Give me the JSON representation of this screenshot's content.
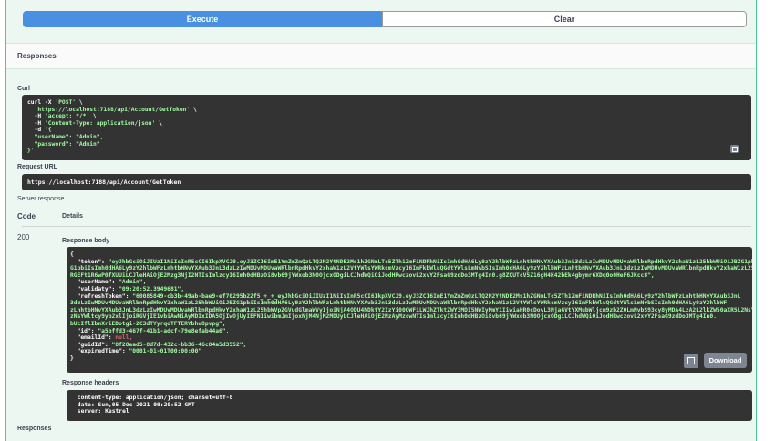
{
  "buttons": {
    "execute": "Execute",
    "clear": "Clear"
  },
  "responses_bar": {
    "title": "Responses"
  },
  "curl": {
    "label": "Curl",
    "lines": [
      {
        "w": "curl -X ",
        "s": "'POST'",
        "t": " \\"
      },
      {
        "w": "  ",
        "s": "'https://localhost:7188/api/Account/GetToken'",
        "t": " \\"
      },
      {
        "w": "  -H ",
        "s": "'accept: */*'",
        "t": " \\"
      },
      {
        "w": "  -H ",
        "s": "'Content-Type: application/json'",
        "t": " \\"
      },
      {
        "w": "  -d ",
        "s": "'{",
        "t": ""
      },
      {
        "w": "",
        "s": "  \"userName\": \"Admin\",",
        "t": ""
      },
      {
        "w": "",
        "s": "  \"password\": \"Admin\"",
        "t": ""
      },
      {
        "w": "",
        "s": "}'",
        "t": ""
      }
    ]
  },
  "request_url": {
    "label": "Request URL",
    "value": "https://localhost:7188/api/Account/GetToken"
  },
  "server_response": {
    "label": "Server response",
    "code_header": "Code",
    "details_header": "Details",
    "code": "200",
    "body_label": "Response body",
    "body_lines": [
      {
        "k": "{",
        "v": "",
        "cls": "k"
      },
      {
        "k": "  \"token\": ",
        "v": "\"eyJhbGciOiJIUzI1NiIsInR5cCI6IkpXVCJ9.eyJ3ZCI6ImE1YmZmZmQzLTQ2N2YtNDE2Ms1hZGNmLTc5ZTh1ZmFiNDRhNiIsImh0dHA6Ly9zY2hlbWFzLnhtbHNvYXAub3JnL3dzLzIwMDUvMDUvaWRlbnRpdHkvY2xhaW1zL25hbWUiOiJBZG1pbiIsImh0dHA6Ly9zY2hlbWF",
        "cls": "s"
      },
      {
        "k": "",
        "v": "G1pbiIsImh0dHA6Ly9zY2hlbWFzLnhtbHNvYXAub3JnL3dzLzIwMDUvMDUvaWRlbnRpdHkvY2xhaW1zL2VtYWlsYWRkcmVzcyI6ImFkbWluQGdtYWlsLmNvbSIsImh0dHA6Ly9zY2hlbWFzLnhtbHNvYXAub3JnL3dzLzIwMDUvMDUvaWRlbnRpdHkvY2xhaW1zL25hbWVpZGVudGlmaWVyIjoiOGYyOGVhZDUtOGQ3ZC00MzJjLWJiMzYtNDZjMDRhNWQzNTUyIiwiaHR0cDovL3NjaGVtYXMubWljcm9zb2Z0LmNvbS93cy8yMDA4LzA2L2lkZW50aXR5L2NsYWltcy9yb2xlIjoi",
        "cls": "s"
      },
      {
        "k": "",
        "v": "RGEFt1R6wP0fXUUiLCJleHAiOjE2Mzg3NjI2NTIsImlzcyI6Imh0dHBzOi8vb69jYWxob3N0OjcxODgiLCJhdWQiOiJodHRwczovL2xvY2FsaG9zdDo3MTg4In0.g8ZQUTcV5Z16gH4K42bEk4gbymr6XDq0o0HeF6JKcc8\",",
        "cls": "s"
      },
      {
        "k": "  \"userName\": ",
        "v": "\"Admin\",",
        "cls": "s"
      },
      {
        "k": "  \"validaty\": ",
        "v": "\"09:20:52.3949681\",",
        "cls": "s"
      },
      {
        "k": "  \"refreshToken\": ",
        "v": "\"60085849-cb3b-49ab-bae9-ef70295b22f5_+_+_eyJhbGciOiJIUzI1NiIsInR5cCI6IkpXVCJ9.eyJ3ZCI6ImE1YmZmZmQzLTQ2N2YtNDE2Ms1hZGNmLTc5ZTh1ZmFiNDRhNiIsImh0dHA6Ly9zY2hlbWFzLnhtbHNvYXAub3JnL",
        "cls": "s"
      },
      {
        "k": "",
        "v": "3dzLzIwMDUvMDUvaWRlbnRpdHkvY2xhaW1zL25hbWUiOiJBZG1pbiIsImh0dHA6Ly9zY2hlbWFzLnhtbHNvYXAub3JnL3dzLzIwMDUvMDUvaWRlbnRpdHkvY2xhaW1zL2VtYWlsYWRkcmVzcyI6ImFkbWluQGdtYWlsLmNvbSIsImh0dHA6Ly9zY2hlbWF",
        "cls": "s"
      },
      {
        "k": "",
        "v": "zLnhtbHNvYXAub3JnL3dzLzIwMDUvMDUvaWRlbnRpdHkvY2xhaW1zL25hbWVpZGVudGlmaWVyIjoiNjA4ODU4NDktY2IzYi00OWFiLWJhZTktZWY3MDI5NWIyMmY1IiwiaHR0cDovL3NjaGVtYXMubWljcm9zb2Z0LmNvbS93cy8yMDA4LzA2L2lkZW50aXR5L2NsYWltcy9yb2xlIjoi",
        "cls": "s"
      },
      {
        "k": "",
        "v": "zNsYWltcy9yb2xlIjoiRGVjIE1vbiAwNiAyMDIxIDA5OjIwOjUyIEFNIiwibmJmIjoxNjM4NjM2MDUyLCJleHAiOjE2NzAyMzcwNTIsImlzcyI6Imh0dHBzOi8vb69jYWxob3N0OjcxODgiLCJhdWQiOiJodHRwczovL2xvY2FsaG9zdDo3MTg4In0.",
        "cls": "s"
      },
      {
        "k": "",
        "v": "bUcIflIbnXriEDotgi-2C3dTYyrqoTFTERYbhu8pvpg\",",
        "cls": "s"
      },
      {
        "k": "  \"id\": ",
        "v": "\"a5bffd3-467f-41b1-adcf-79e8efab44a6\",",
        "cls": "s"
      },
      {
        "k": "  \"emailId\": ",
        "v": "null,",
        "cls": "n"
      },
      {
        "k": "  \"guidId\": ",
        "v": "\"8f28ead5-8d7d-432c-bb36-46c04a5d3552\",",
        "cls": "s"
      },
      {
        "k": "  \"expiredTime\": ",
        "v": "\"0001-01-01T00:00:00\"",
        "cls": "s"
      },
      {
        "k": "}",
        "v": "",
        "cls": "k"
      }
    ],
    "download_label": "Download",
    "headers_label": "Response headers",
    "header_lines": [
      " content-type: application/json; charset=utf-8",
      " date: Sun,05 Dec 2021 09:20:52 GMT",
      " server: Kestrel"
    ]
  },
  "responses_footer": {
    "title": "Responses"
  }
}
